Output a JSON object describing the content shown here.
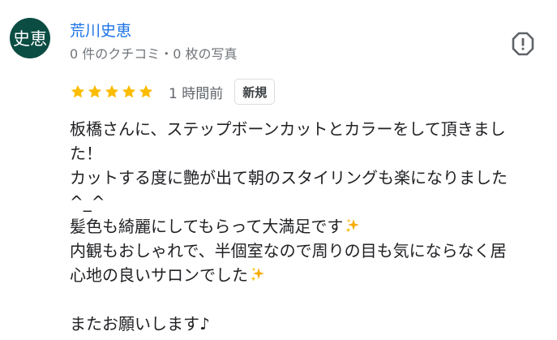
{
  "reviewer": {
    "avatar_text": "史恵",
    "avatar_color": "#0b4d43",
    "name": "荒川史恵",
    "meta": "0 件のクチコミ・0 枚の写真"
  },
  "rating": {
    "stars": 5,
    "max_stars": 5,
    "star_color": "#fbbc04",
    "time_ago": "1 時間前",
    "badge": "新規"
  },
  "actions": {
    "flag_icon": "report-flag-icon"
  },
  "review": {
    "lines": [
      "板橋さんに、ステップボーンカットとカラーをして頂きまし",
      "た！",
      "カットする度に艶が出て朝のスタイリングも楽になりました",
      "^_^",
      "髪色も綺麗にしてもらって大満足です",
      "内観もおしゃれで、半個室なので周りの目も気にならなく居",
      "心地の良いサロンでした",
      "",
      "またお願いします♪"
    ],
    "sparkle_icon": "sparkles-emoji"
  },
  "colors": {
    "link": "#1a73e8",
    "secondary_text": "#70757a",
    "body_text": "#202124"
  }
}
